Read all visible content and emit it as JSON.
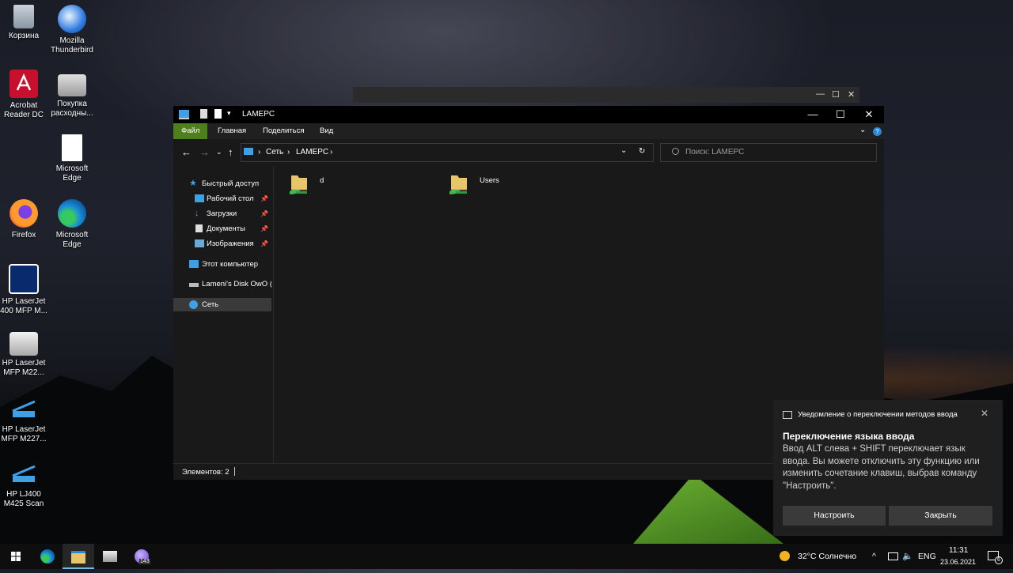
{
  "desktop": {
    "icons": [
      {
        "label": "Корзина"
      },
      {
        "label": "Mozilla Thunderbird"
      },
      {
        "label": "Acrobat Reader DC"
      },
      {
        "label": "Покупка расходны..."
      },
      {
        "label": "Microsoft Edge"
      },
      {
        "label": "Firefox"
      },
      {
        "label": "Microsoft Edge"
      },
      {
        "label": "HP LaserJet 400 MFP M..."
      },
      {
        "label": "HP LaserJet MFP M22..."
      },
      {
        "label": "HP LaserJet MFP M227..."
      },
      {
        "label": "HP LJ400 M425 Scan"
      }
    ]
  },
  "background_window": {
    "minimize": "—",
    "maximize": "☐",
    "close": "✕"
  },
  "explorer": {
    "title": "LAMEPC",
    "window_controls": {
      "minimize": "—",
      "maximize": "☐",
      "close": "✕"
    },
    "ribbon_tabs": [
      "Файл",
      "Главная",
      "Поделиться",
      "Вид"
    ],
    "address": {
      "root": "Сеть",
      "separator": "›",
      "current": "LAMEPC"
    },
    "search_placeholder": "Поиск: LAMEPC",
    "nav_items": [
      {
        "label": "Быстрый доступ",
        "pinned": false
      },
      {
        "label": "Рабочий стол",
        "pinned": true
      },
      {
        "label": "Загрузки",
        "pinned": true
      },
      {
        "label": "Документы",
        "pinned": true
      },
      {
        "label": "Изображения",
        "pinned": true
      },
      {
        "label": "Этот компьютер",
        "pinned": false
      },
      {
        "label": "Lameni's Disk OwO (I",
        "pinned": false
      },
      {
        "label": "Сеть",
        "pinned": false,
        "selected": true
      }
    ],
    "pin_glyph": "📌",
    "folders": [
      {
        "name": "d"
      },
      {
        "name": "Users"
      }
    ],
    "status": "Элементов: 2"
  },
  "notification": {
    "header": "Уведомление о переключении методов ввода",
    "title": "Переключение языка ввода",
    "body": "Ввод ALT слева + SHIFT переключает язык ввода. Вы можете отключить эту функцию или изменить сочетание клавиш, выбрав команду \"Настроить\".",
    "buttons": {
      "configure": "Настроить",
      "close": "Закрыть"
    }
  },
  "taskbar": {
    "badge": "143",
    "weather": "32°C  Солнечно",
    "chevron": "^",
    "lang": "ENG",
    "time": "11:31",
    "date": "23.06.2021",
    "notif_count": "6"
  },
  "colors": {
    "file_tab": "#4f7f1c",
    "accent": "#76b9ed",
    "folder": "#e8c56a"
  }
}
